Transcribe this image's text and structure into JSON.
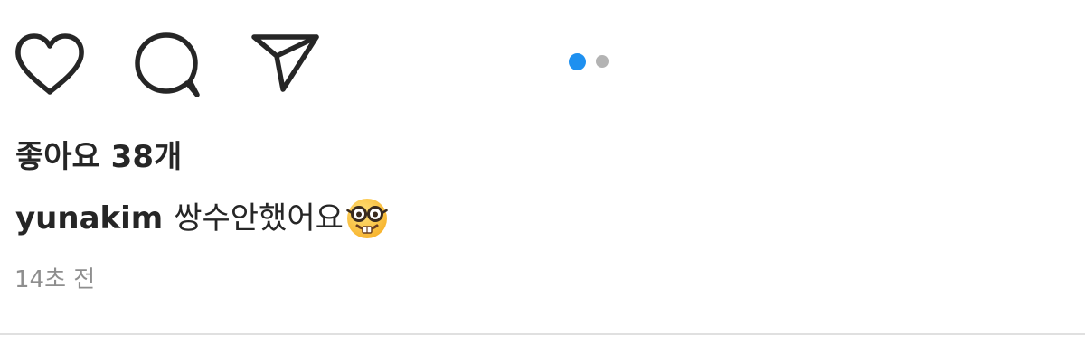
{
  "actions": {
    "like_icon": "heart-outline",
    "comment_icon": "speech-bubble-outline",
    "share_icon": "paper-plane-outline"
  },
  "carousel": {
    "total": 2,
    "active_index": 1,
    "active_color": "#1e90f0",
    "inactive_color": "#b3b3b3"
  },
  "post": {
    "likes_text": "좋아요 38개",
    "username": "yunakim",
    "caption_text": "쌍수안했어요",
    "caption_emoji": "nerd-face-emoji",
    "timestamp": "14초 전"
  },
  "colors": {
    "text": "#262626",
    "secondary_text": "#8e8e8e",
    "icon_stroke": "#262626",
    "divider": "#e0e0e0"
  }
}
